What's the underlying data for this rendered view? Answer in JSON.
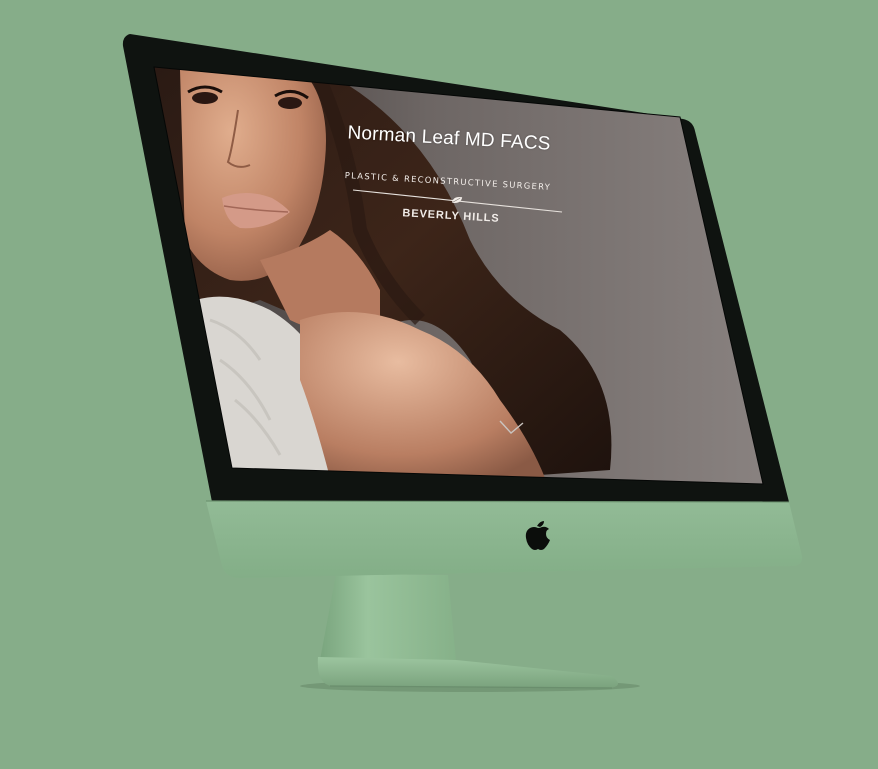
{
  "website": {
    "title": "Norman Leaf MD FACS",
    "subtitle": "PLASTIC & RECONSTRUCTIVE SURGERY",
    "location": "BEVERLY HILLS"
  },
  "icons": {
    "divider": "leaf-icon",
    "scroll": "chevron-down-icon",
    "brand": "apple-logo-icon"
  },
  "colors": {
    "background": "#86ad89",
    "monitor_chin": "#8ab48e",
    "bezel": "#0e120f",
    "hero_text": "#ffffff"
  }
}
